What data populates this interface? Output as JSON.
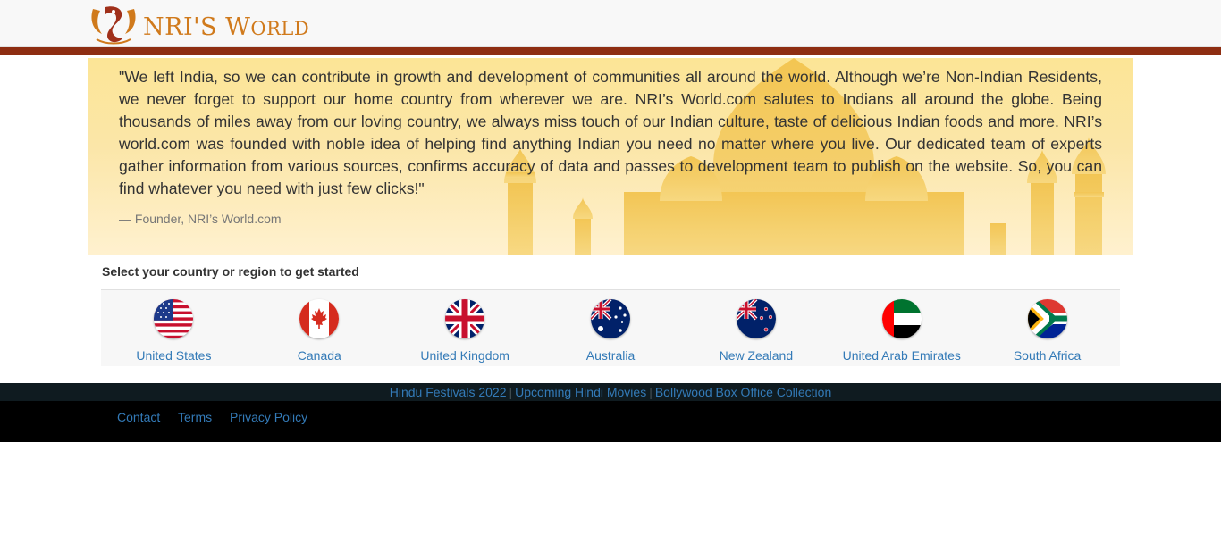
{
  "header": {
    "brand": {
      "part1": "NRI'S",
      "part2": "W",
      "part3": "ORLD"
    },
    "colors": {
      "logo": "#d07a1c",
      "rule": "#8e2e12"
    }
  },
  "hero": {
    "quote": "\"We left India, so we can contribute in growth and development of communities all around the world. Although we’re Non-Indian Residents, we never forget to support our home country from wherever we are. NRI’s World.com salutes to Indians all around the globe. Being thousands of miles away from our loving country, we always miss touch of our Indian culture, taste of delicious Indian foods and more. NRI’s world.com was founded with noble idea of helping find anything Indian you need no matter where you live. Our dedicated team of experts gather information from various sources, confirms accuracy of data and passes to development team to publish on the website. So, you can find whatever you need with just few clicks!\"",
    "attribution": "— Founder, NRI’s World.com"
  },
  "country_select": {
    "title": "Select your country or region to get started",
    "countries": [
      {
        "label": "United States",
        "icon": "us-flag-icon"
      },
      {
        "label": "Canada",
        "icon": "canada-flag-icon"
      },
      {
        "label": "United Kingdom",
        "icon": "uk-flag-icon"
      },
      {
        "label": "Australia",
        "icon": "australia-flag-icon"
      },
      {
        "label": "New Zealand",
        "icon": "new-zealand-flag-icon"
      },
      {
        "label": "United Arab Emirates",
        "icon": "uae-flag-icon"
      },
      {
        "label": "South Africa",
        "icon": "south-africa-flag-icon"
      }
    ]
  },
  "links_bar": {
    "links": [
      "Hindu Festivals 2022",
      "Upcoming Hindi Movies",
      "Bollywood Box Office Collection"
    ],
    "separator": "|"
  },
  "footer": {
    "links": [
      "Contact",
      "Terms",
      "Privacy Policy"
    ]
  }
}
